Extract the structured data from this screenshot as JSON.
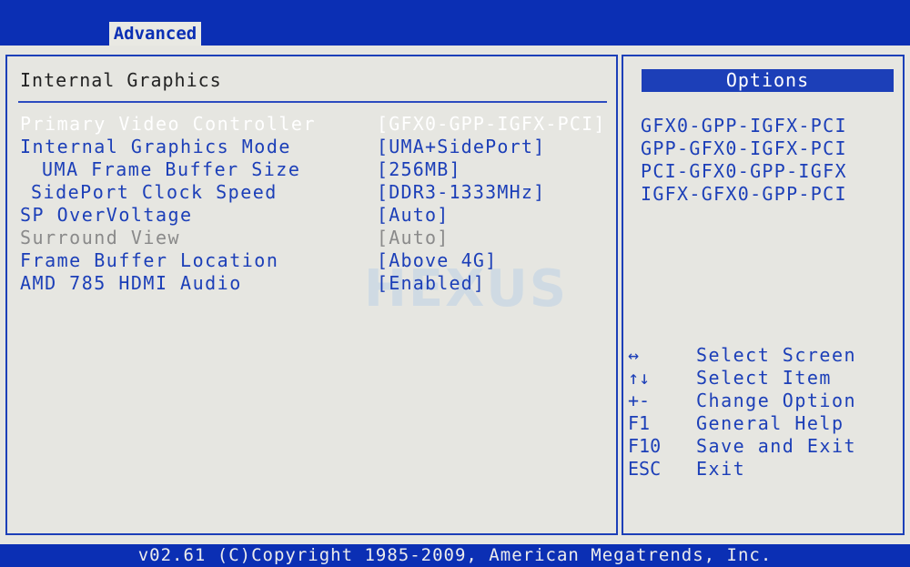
{
  "tabs": {
    "active": "Advanced"
  },
  "section": {
    "title": "Internal Graphics"
  },
  "settings": [
    {
      "label": "Primary Video Controller",
      "value": "[GFX0-GPP-IGFX-PCI]",
      "indent": 0,
      "state": "selected"
    },
    {
      "label": "Internal Graphics Mode",
      "value": "[UMA+SidePort]",
      "indent": 0,
      "state": "normal"
    },
    {
      "label": "UMA Frame Buffer Size",
      "value": "[256MB]",
      "indent": 2,
      "state": "normal"
    },
    {
      "label": "SidePort Clock Speed",
      "value": "[DDR3-1333MHz]",
      "indent": 1,
      "state": "normal"
    },
    {
      "label": "SP OverVoltage",
      "value": "[Auto]",
      "indent": 0,
      "state": "normal"
    },
    {
      "label": "Surround View",
      "value": "[Auto]",
      "indent": 0,
      "state": "disabled"
    },
    {
      "label": "Frame Buffer Location",
      "value": "[Above 4G]",
      "indent": 0,
      "state": "normal"
    },
    {
      "label": "AMD 785 HDMI Audio",
      "value": "[Enabled]",
      "indent": 0,
      "state": "normal"
    }
  ],
  "options": {
    "header": "Options",
    "items": [
      "GFX0-GPP-IGFX-PCI",
      "GPP-GFX0-IGFX-PCI",
      "PCI-GFX0-GPP-IGFX",
      "IGFX-GFX0-GPP-PCI"
    ]
  },
  "help": [
    {
      "key": "↔",
      "text": "Select Screen"
    },
    {
      "key": "↑↓",
      "text": "Select Item"
    },
    {
      "key": "+-",
      "text": "Change Option"
    },
    {
      "key": "F1",
      "text": "General Help"
    },
    {
      "key": "F10",
      "text": "Save and Exit"
    },
    {
      "key": "ESC",
      "text": "Exit"
    }
  ],
  "footer": "v02.61 (C)Copyright 1985-2009, American Megatrends, Inc.",
  "watermark": "HEXUS",
  "colors": {
    "bios_blue": "#0b2fb4",
    "panel_gray": "#e6e6e1",
    "text_blue": "#1c3fb8"
  }
}
